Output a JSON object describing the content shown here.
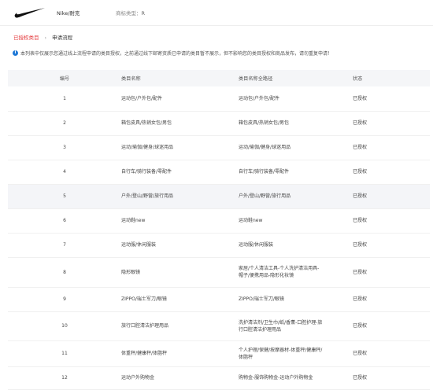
{
  "header": {
    "brand_name": "Nike/耐克",
    "brand_type_label": "商标类型：",
    "brand_type_value": "R"
  },
  "breadcrumb": {
    "parent": "已授权类目",
    "separator": "›",
    "current": "申请流程"
  },
  "notice": {
    "icon": "info-icon",
    "text": "本列表中仅展示您通过线上流程申请的类目授权，之前通过线下邮寄资质已申请的类目暂不展示，但不影响您的类目授权和商品发布，请勿重复申请！"
  },
  "table": {
    "columns": [
      "编号",
      "类目名称",
      "类目名称全路径",
      "状态"
    ],
    "rows": [
      {
        "num": "1",
        "name": "运动包/户外包/配件",
        "path": "运动包/户外包/配件",
        "status": "已授权"
      },
      {
        "num": "2",
        "name": "箱包皮具/热销女包/男包",
        "path": "箱包皮具/热销女包/男包",
        "status": "已授权"
      },
      {
        "num": "3",
        "name": "运动/瑜伽/健身/球迷用品",
        "path": "运动/瑜伽/健身/球迷用品",
        "status": "已授权"
      },
      {
        "num": "4",
        "name": "自行车/骑行装备/零配件",
        "path": "自行车/骑行装备/零配件",
        "status": "已授权"
      },
      {
        "num": "5",
        "name": "户外/登山/野营/旅行用品",
        "path": "户外/登山/野营/旅行用品",
        "status": "已授权"
      },
      {
        "num": "6",
        "name": "运动鞋new",
        "path": "运动鞋new",
        "status": "已授权"
      },
      {
        "num": "7",
        "name": "运动服/休闲服装",
        "path": "运动服/休闲服装",
        "status": "已授权"
      },
      {
        "num": "8",
        "name": "隐形眼镜",
        "path_line1": "家居/个人清洁工具-个人洗护清洁用具-",
        "path_line2": "帽子/便携用品-隐形化妆镜",
        "status": "已授权"
      },
      {
        "num": "9",
        "name": "ZIPPO/瑞士军刀/眼镜",
        "path": "ZIPPO/瑞士军刀/眼镜",
        "status": "已授权"
      },
      {
        "num": "10",
        "name": "旅行口腔清洁护理用品",
        "path_line1": "洗护清洁剂/卫生巾/纸/香薰-口腔护理-旅",
        "path_line2": "行口腔清洁护理用品",
        "status": "已授权"
      },
      {
        "num": "11",
        "name": "体重秤/健康秤/体脂秤",
        "path_line1": "个人护理/保健/按摩器材-体重秤/健康秤/",
        "path_line2": "体脂秤",
        "status": "已授权"
      },
      {
        "num": "12",
        "name": "运动户外购物金",
        "path": "购物金-服饰购物金-运动户外购物金",
        "status": "已授权"
      }
    ]
  }
}
